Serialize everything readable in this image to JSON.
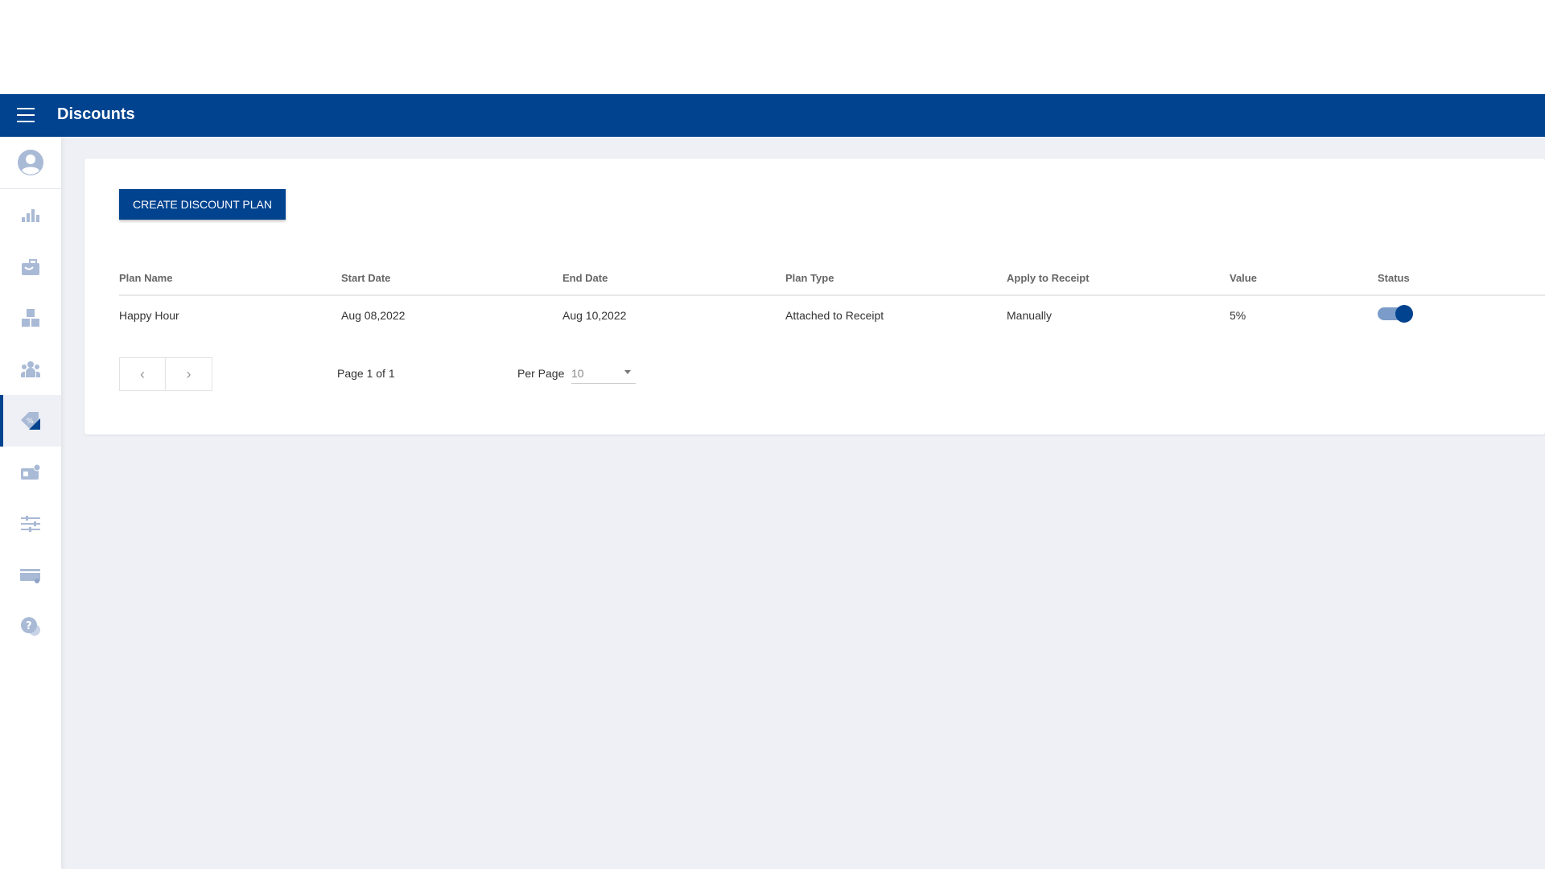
{
  "header": {
    "title": "Discounts"
  },
  "sidebar": {
    "items": [
      {
        "icon": "bar-chart-icon"
      },
      {
        "icon": "shopping-bag-icon"
      },
      {
        "icon": "boxes-icon"
      },
      {
        "icon": "people-icon"
      },
      {
        "icon": "discount-tag-icon",
        "active": true
      },
      {
        "icon": "id-card-icon"
      },
      {
        "icon": "sliders-icon"
      },
      {
        "icon": "payment-card-icon"
      },
      {
        "icon": "help-chat-icon"
      }
    ]
  },
  "toolbar": {
    "create_label": "CREATE DISCOUNT PLAN"
  },
  "table": {
    "columns": [
      "Plan Name",
      "Start Date",
      "End Date",
      "Plan Type",
      "Apply to Receipt",
      "Value",
      "Status"
    ],
    "rows": [
      {
        "plan_name": "Happy Hour",
        "start_date": "Aug 08,2022",
        "end_date": "Aug 10,2022",
        "plan_type": "Attached to Receipt",
        "apply_to_receipt": "Manually",
        "value": "5%",
        "status": true
      }
    ]
  },
  "pagination": {
    "prev": "‹",
    "next": "›",
    "page_info": "Page 1 of 1",
    "per_page_label": "Per Page",
    "per_page_value": "10"
  },
  "colors": {
    "primary": "#01438f",
    "background": "#eef0f5"
  }
}
